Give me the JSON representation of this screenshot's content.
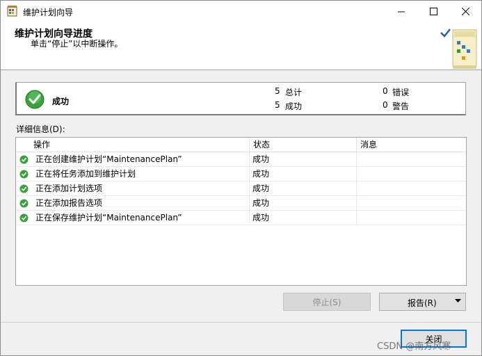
{
  "window": {
    "title": "维护计划向导",
    "controls": {
      "minimize": "—",
      "maximize": "☐",
      "close": "✕"
    }
  },
  "header": {
    "title": "维护计划向导进度",
    "subtitle": "单击“停止”以中断操作。"
  },
  "summary": {
    "status": "成功",
    "stats": [
      {
        "count": "5",
        "label": "总计"
      },
      {
        "count": "0",
        "label": "错误"
      },
      {
        "count": "5",
        "label": "成功"
      },
      {
        "count": "0",
        "label": "警告"
      }
    ]
  },
  "details": {
    "label": "详细信息(D):",
    "columns": [
      "操作",
      "状态",
      "消息"
    ],
    "rows": [
      {
        "action": "正在创建维护计划“MaintenancePlan”",
        "status": "成功",
        "message": ""
      },
      {
        "action": "正在将任务添加到维护计划",
        "status": "成功",
        "message": ""
      },
      {
        "action": "正在添加计划选项",
        "status": "成功",
        "message": ""
      },
      {
        "action": "正在添加报告选项",
        "status": "成功",
        "message": ""
      },
      {
        "action": "正在保存维护计划“MaintenancePlan”",
        "status": "成功",
        "message": ""
      }
    ]
  },
  "buttons": {
    "stop": "停止(S)",
    "report": "报告(R)",
    "close": "关闭"
  },
  "watermark": "CSDN @南方风寒",
  "colors": {
    "success_green": "#2f9e2f",
    "focus_blue": "#0078d7"
  }
}
